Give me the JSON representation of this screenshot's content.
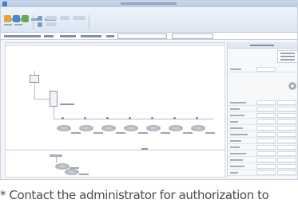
{
  "caption": "* Contact the administrator for authorization to",
  "icons": [
    "app-icon",
    "minimize-icon",
    "maximize-icon",
    "close-icon",
    "gear-icon"
  ],
  "colors": {
    "title_bar": "#b5c9e2",
    "ribbon": "#dce6f3",
    "canvas": "#ffffff",
    "panel": "#f7f8fa",
    "caption_text": "#4a4d52"
  }
}
